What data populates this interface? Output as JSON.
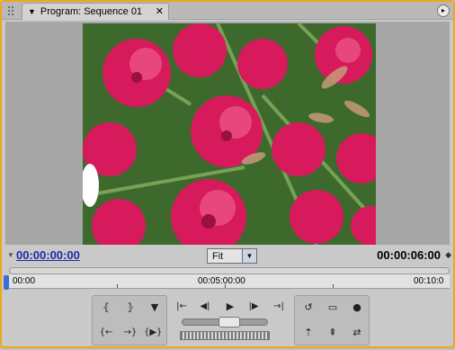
{
  "panel": {
    "tab_title": "Program: Sequence 01",
    "tab_close": "✕",
    "menu_glyph": "▸"
  },
  "timecode": {
    "current": "00:00:00:00",
    "duration": "00:00:06:00",
    "zoom_value": "Fit"
  },
  "ruler": {
    "labels": [
      "00:00",
      "00:05:00:00",
      "00:10:0"
    ]
  },
  "controls": {
    "mark_in": "⦃",
    "mark_out": "⦄",
    "set_marker": "▼",
    "go_to_in": "{←",
    "go_to_out": "→}",
    "play_in_to_out": "{▶}",
    "go_prev_edit": "|←",
    "step_back": "◀|",
    "play": "▶",
    "step_forward": "|▶",
    "go_next_edit": "→|",
    "loop": "↺",
    "safe_margins": "▭",
    "output": "●",
    "lift": "⇡",
    "extract": "⇞",
    "trim": "⇄"
  },
  "colors": {
    "accent_border": "#f0a619",
    "timecode_blue": "#1d2ea8",
    "playhead": "#3a6fd1"
  }
}
